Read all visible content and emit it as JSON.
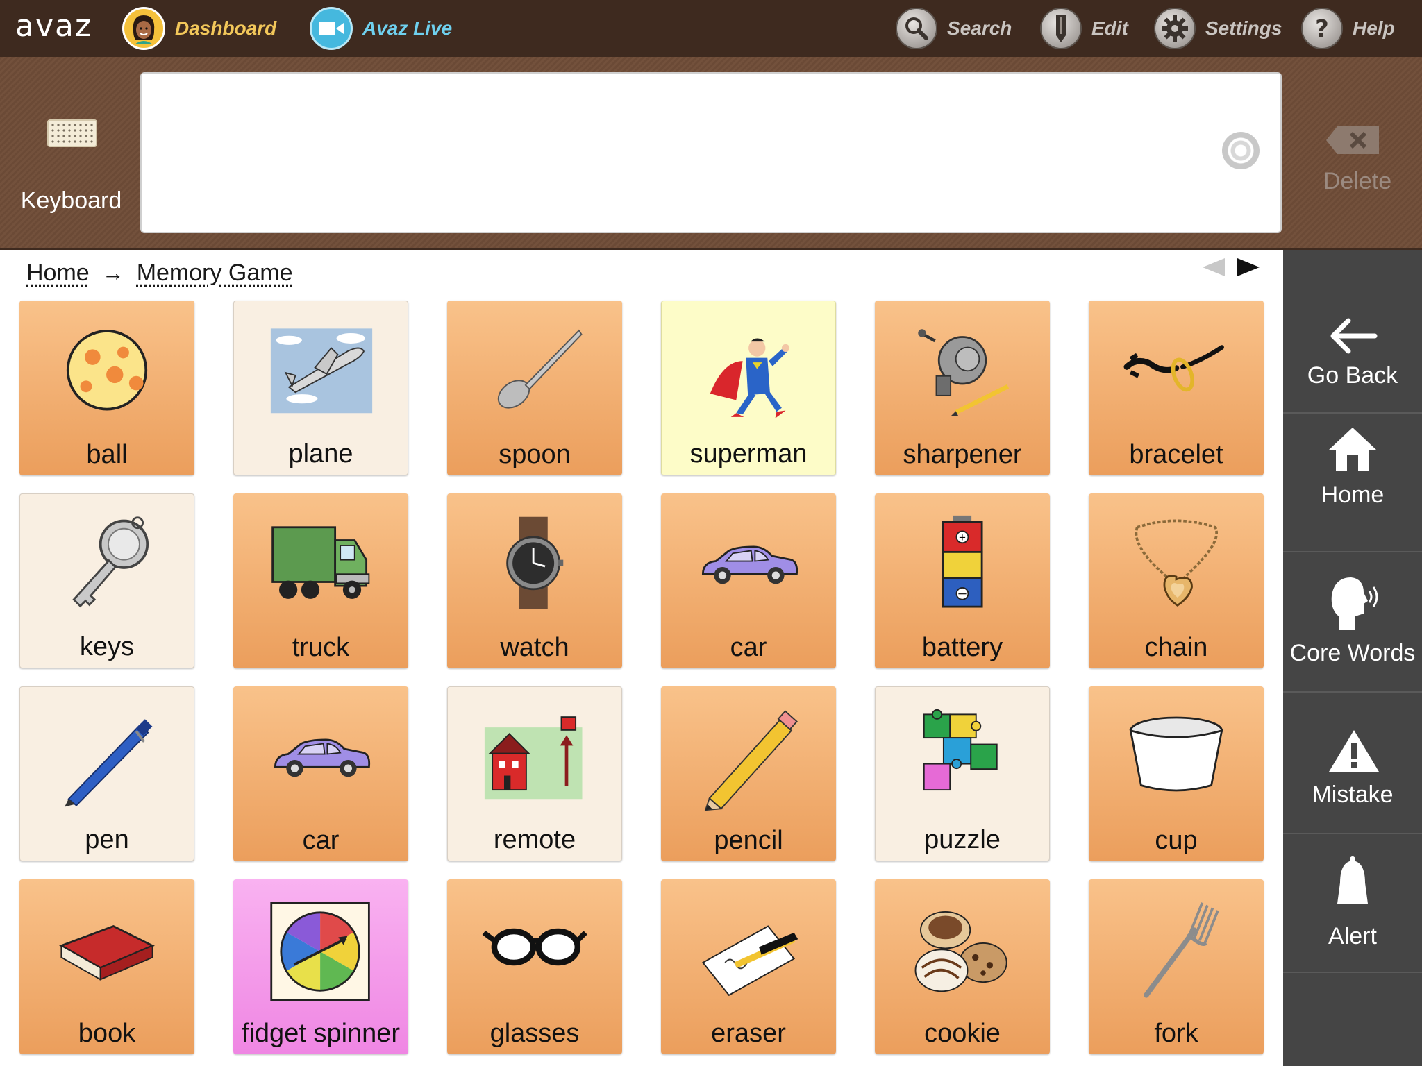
{
  "app": {
    "logo": "avaz"
  },
  "topbar": {
    "dashboard_label": "Dashboard",
    "live_label": "Avaz Live",
    "search_label": "Search",
    "edit_label": "Edit",
    "settings_label": "Settings",
    "help_label": "Help"
  },
  "message": {
    "keyboard_label": "Keyboard",
    "delete_label": "Delete",
    "text": ""
  },
  "breadcrumb": {
    "home": "Home",
    "arrow": "→",
    "current": "Memory Game"
  },
  "tiles": [
    {
      "label": "ball",
      "icon": "ball-icon",
      "color": "orange"
    },
    {
      "label": "plane",
      "icon": "plane-icon",
      "color": "cream"
    },
    {
      "label": "spoon",
      "icon": "spoon-icon",
      "color": "orange"
    },
    {
      "label": "superman",
      "icon": "superman-icon",
      "color": "yellow"
    },
    {
      "label": "sharpener",
      "icon": "sharpener-icon",
      "color": "orange"
    },
    {
      "label": "bracelet",
      "icon": "bracelet-icon",
      "color": "orange"
    },
    {
      "label": "keys",
      "icon": "keys-icon",
      "color": "cream"
    },
    {
      "label": "truck",
      "icon": "truck-icon",
      "color": "orange"
    },
    {
      "label": "watch",
      "icon": "watch-icon",
      "color": "orange"
    },
    {
      "label": "car",
      "icon": "car-icon",
      "color": "orange"
    },
    {
      "label": "battery",
      "icon": "battery-icon",
      "color": "orange"
    },
    {
      "label": "chain",
      "icon": "chain-icon",
      "color": "orange"
    },
    {
      "label": "pen",
      "icon": "pen-icon",
      "color": "cream"
    },
    {
      "label": "car",
      "icon": "car-icon",
      "color": "orange"
    },
    {
      "label": "remote",
      "icon": "remote-icon",
      "color": "cream"
    },
    {
      "label": "pencil",
      "icon": "pencil-icon",
      "color": "orange"
    },
    {
      "label": "puzzle",
      "icon": "puzzle-icon",
      "color": "cream"
    },
    {
      "label": "cup",
      "icon": "cup-icon",
      "color": "orange"
    },
    {
      "label": "book",
      "icon": "book-icon",
      "color": "orange"
    },
    {
      "label": "fidget spinner",
      "icon": "fidget-spinner-icon",
      "color": "pink"
    },
    {
      "label": "glasses",
      "icon": "glasses-icon",
      "color": "orange"
    },
    {
      "label": "eraser",
      "icon": "eraser-icon",
      "color": "orange"
    },
    {
      "label": "cookie",
      "icon": "cookie-icon",
      "color": "orange"
    },
    {
      "label": "fork",
      "icon": "fork-icon",
      "color": "orange"
    }
  ],
  "sidebar": {
    "items": [
      {
        "label": "Go Back",
        "icon": "arrow-left-icon"
      },
      {
        "label": "Home",
        "icon": "home-icon"
      },
      {
        "label": "Core Words",
        "icon": "speaking-head-icon"
      },
      {
        "label": "Mistake",
        "icon": "warning-icon"
      },
      {
        "label": "Alert",
        "icon": "bell-icon"
      }
    ]
  },
  "colors": {
    "topbar": "#3e2a1f",
    "tile_orange": "#eb9e5c",
    "tile_cream": "#f9efe2",
    "tile_yellow": "#fdfcc8",
    "tile_pink": "#ef86e3",
    "sidebar": "#454545"
  }
}
